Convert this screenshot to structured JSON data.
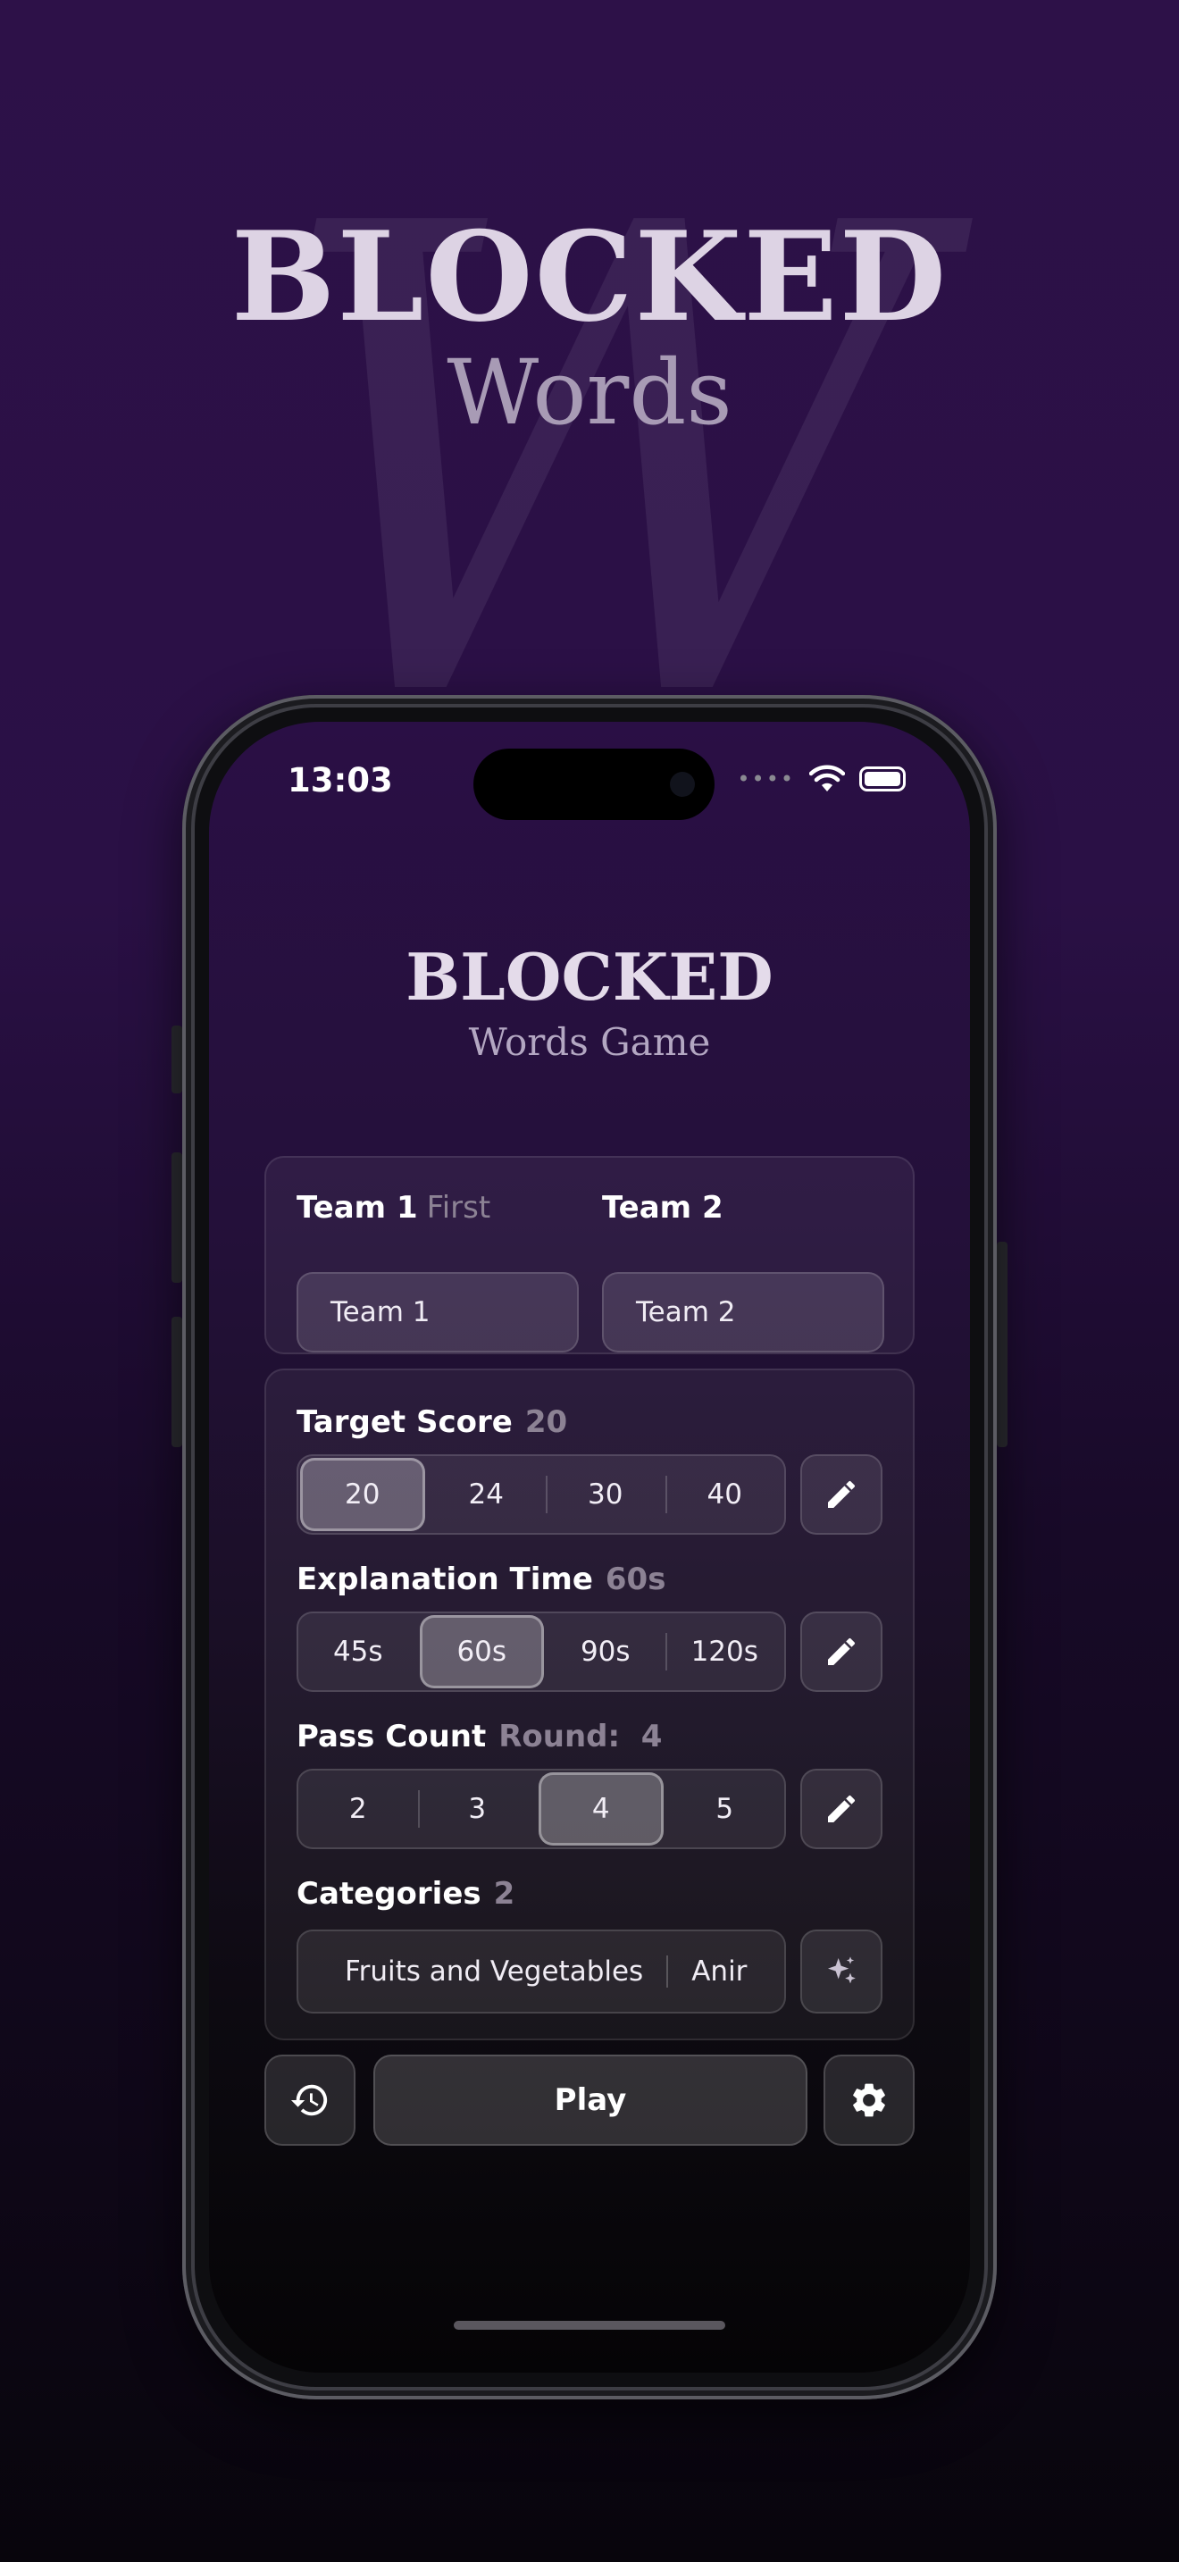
{
  "hero": {
    "title": "BLOCKED",
    "subtitle": "Words",
    "watermark": "W"
  },
  "status_bar": {
    "time": "13:03",
    "signal": "••••"
  },
  "app": {
    "title": "BLOCKED",
    "subtitle": "Words Game"
  },
  "teams": [
    {
      "label": "Team 1",
      "badge": "First",
      "value": "Team 1"
    },
    {
      "label": "Team 2",
      "badge": "",
      "value": "Team 2"
    }
  ],
  "target_score": {
    "label": "Target Score",
    "value": "20",
    "options": [
      "20",
      "24",
      "30",
      "40"
    ],
    "selected": 0
  },
  "explanation_time": {
    "label": "Explanation Time",
    "value": "60s",
    "options": [
      "45s",
      "60s",
      "90s",
      "120s"
    ],
    "selected": 1
  },
  "pass_count": {
    "label": "Pass Count",
    "value": "Round:  4",
    "options": [
      "2",
      "3",
      "4",
      "5"
    ],
    "selected": 2
  },
  "categories": {
    "label": "Categories",
    "count": "2",
    "items": [
      "Fruits and Vegetables",
      "Anir"
    ]
  },
  "actions": {
    "play_label": "Play"
  },
  "colors": {
    "accent_bg": "#2d1148",
    "card_border": "rgba(255,255,255,0.10)"
  },
  "icons": {
    "edit": "pencil-icon",
    "magic": "sparkles-icon",
    "history": "history-icon",
    "settings": "gear-icon",
    "wifi": "wifi-icon",
    "battery": "battery-icon"
  }
}
